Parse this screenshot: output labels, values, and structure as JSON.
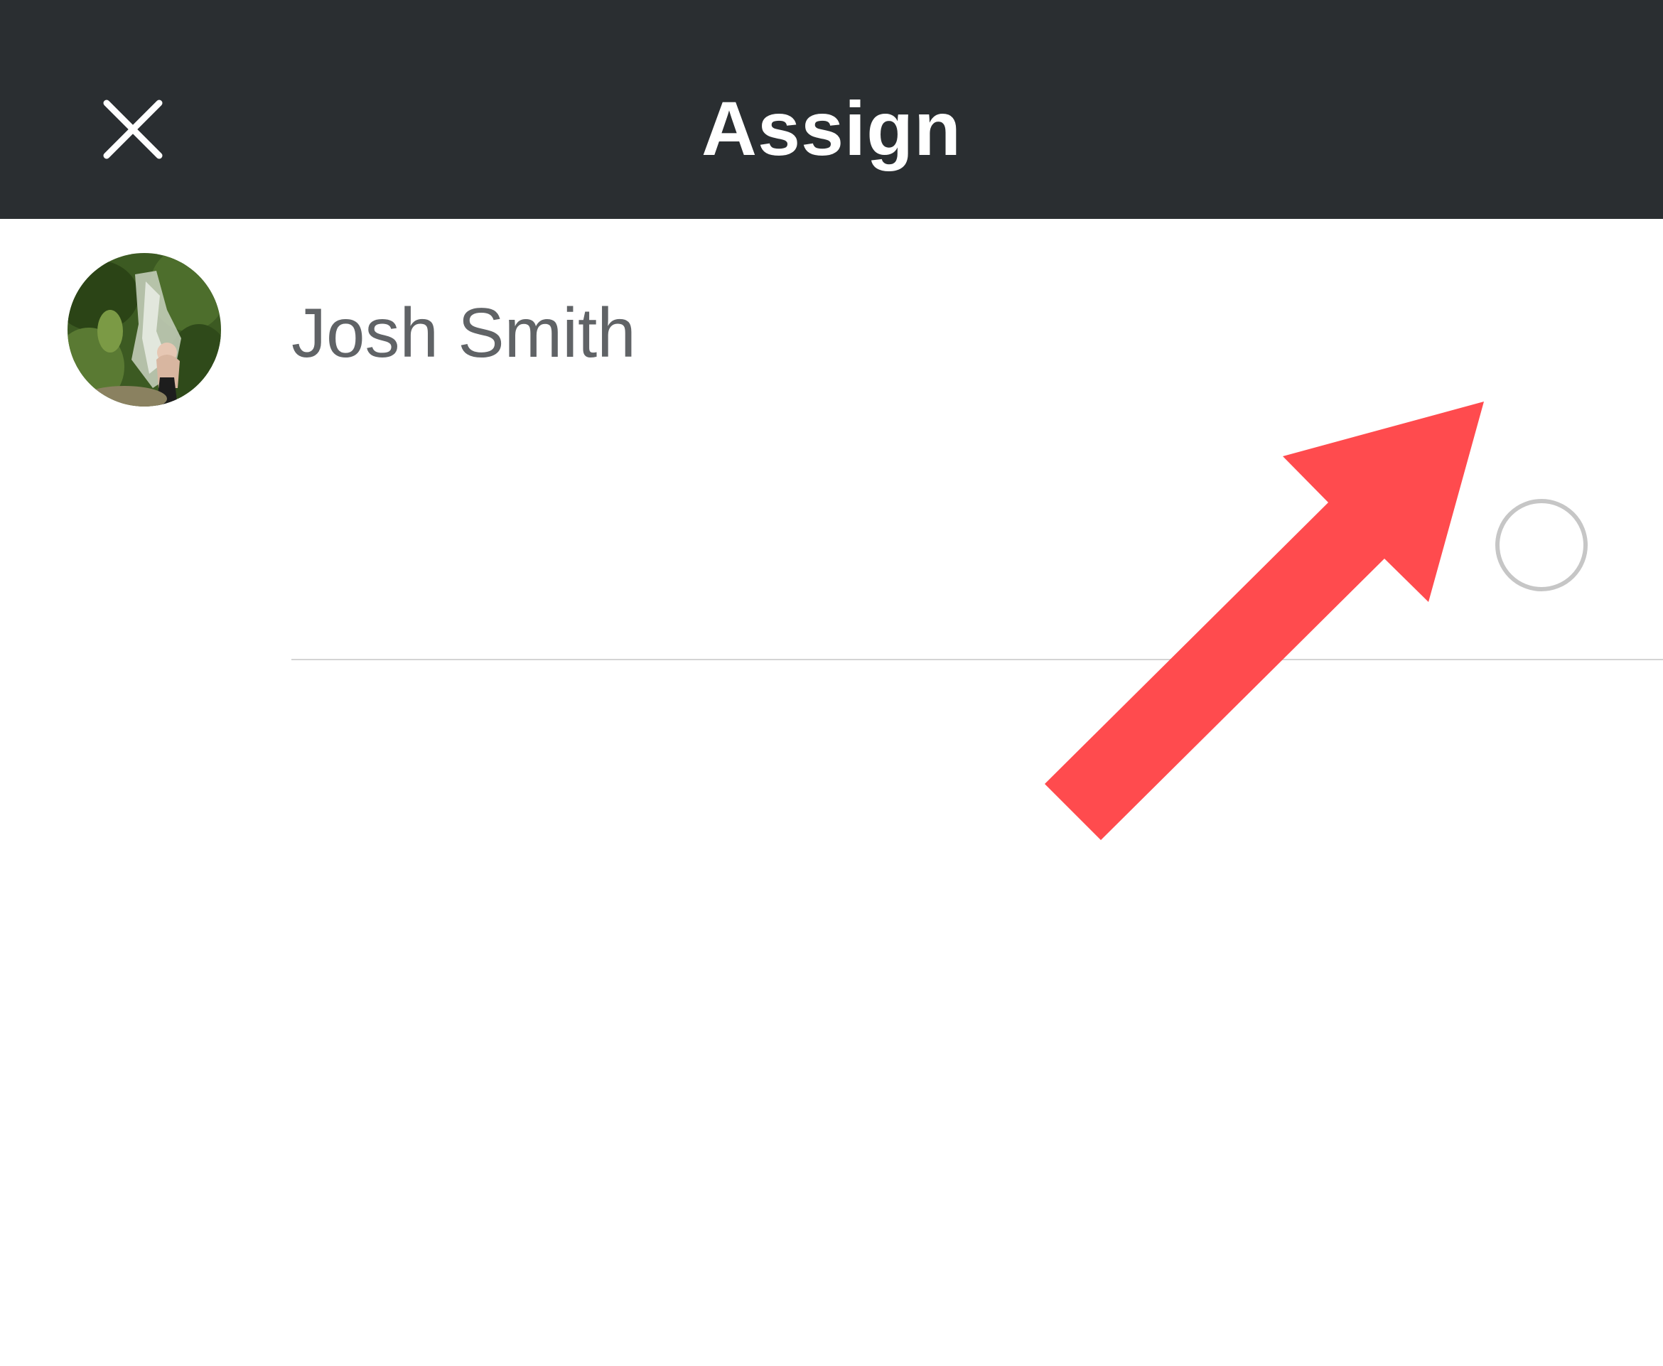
{
  "header": {
    "title": "Assign",
    "close_icon": "close-icon"
  },
  "assignees": [
    {
      "name": "Josh Smith",
      "avatar": "profile-photo",
      "selected": false
    }
  ],
  "annotation": {
    "icon": "red-arrow-pointer",
    "color": "#ff4b4e"
  },
  "colors": {
    "header_bg": "#2a2e31",
    "header_text": "#ffffff",
    "name_text": "#606366",
    "radio_border": "#c6c6c6",
    "divider": "#d4d4d4"
  }
}
